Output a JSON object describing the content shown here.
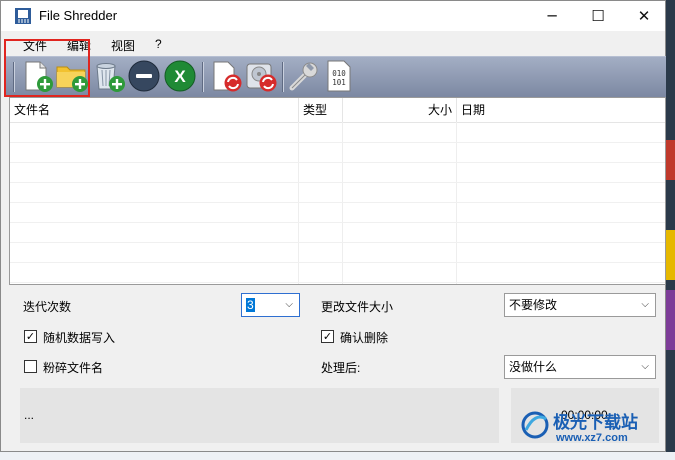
{
  "window": {
    "title": "File Shredder",
    "minimize_glyph": "─",
    "maximize_glyph": "☐",
    "close_glyph": "✕"
  },
  "menu": [
    "文件",
    "编辑",
    "视图",
    "?"
  ],
  "toolbar": {
    "icons": [
      "add-file-icon",
      "add-folder-icon",
      "add-recycle-bin-icon",
      "remove-icon",
      "clear-icon",
      "shred-files-icon",
      "shred-disk-icon",
      "settings-wrench-icon",
      "binary-file-icon"
    ],
    "binary_text_1": "010",
    "binary_text_2": "101",
    "clear_glyph": "X"
  },
  "file_list": {
    "columns": [
      "文件名",
      "类型",
      "大小",
      "日期"
    ]
  },
  "options": {
    "iterations_label": "迭代次数",
    "iterations_value": "3",
    "change_size_label": "更改文件大小",
    "change_size_value": "不要修改",
    "random_write_label": "随机数据写入",
    "random_write_checked": true,
    "confirm_delete_label": "确认删除",
    "confirm_delete_checked": true,
    "shred_names_label": "粉碎文件名",
    "shred_names_checked": false,
    "after_label": "处理后:",
    "after_value": "没做什么"
  },
  "status": {
    "progress_text": "...",
    "time": "00:00:00"
  },
  "watermark": {
    "text": "极光下载站",
    "url": "www.xz7.com"
  },
  "colors": {
    "highlight_box": "#e0251f",
    "toolbar_top": "#a3aec4",
    "toolbar_bottom": "#7c88a2",
    "watermark_blue": "#1a5fb4"
  }
}
